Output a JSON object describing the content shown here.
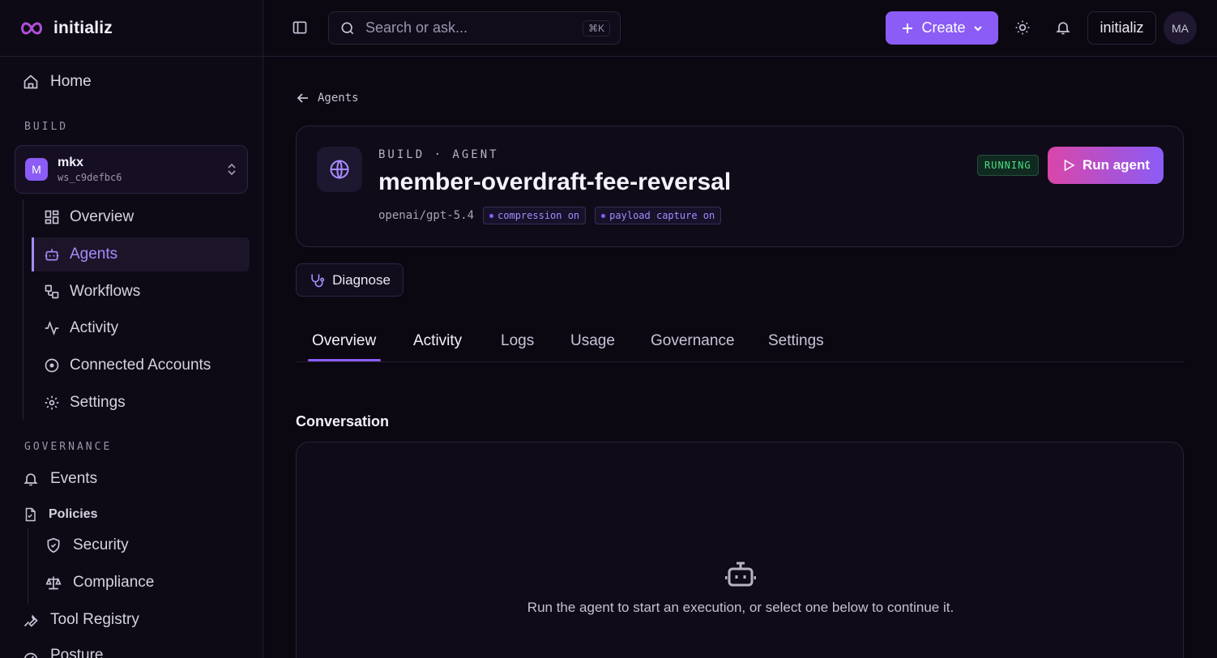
{
  "brand": {
    "name": "initializ"
  },
  "sidebar": {
    "home_label": "Home",
    "build_section_label": "BUILD",
    "workspace": {
      "avatar_letter": "M",
      "name": "mkx",
      "id": "ws_c9defbc6"
    },
    "build_items": [
      {
        "label": "Overview",
        "icon": "grid-icon"
      },
      {
        "label": "Agents",
        "icon": "bot-icon",
        "active": true
      },
      {
        "label": "Workflows",
        "icon": "workflow-icon"
      },
      {
        "label": "Activity",
        "icon": "activity-icon"
      },
      {
        "label": "Connected Accounts",
        "icon": "plug-icon"
      },
      {
        "label": "Settings",
        "icon": "gear-icon"
      }
    ],
    "governance_section_label": "GOVERNANCE",
    "governance_items": {
      "events": "Events",
      "policies": "Policies",
      "security": "Security",
      "compliance": "Compliance",
      "tool_registry": "Tool Registry",
      "posture": "Posture"
    }
  },
  "topbar": {
    "search_placeholder": "Search or ask...",
    "search_shortcut": "⌘K",
    "create_label": "Create",
    "org_label": "initializ",
    "avatar_initials": "MA"
  },
  "breadcrumb": {
    "back_label": "Agents"
  },
  "agent": {
    "eyebrow": "BUILD · AGENT",
    "name": "member-overdraft-fee-reversal",
    "model": "openai/gpt-5.4",
    "pills": [
      "compression on",
      "payload capture on"
    ],
    "status": "RUNNING",
    "run_label": "Run agent"
  },
  "diagnose_label": "Diagnose",
  "tabs": [
    "Overview",
    "Activity",
    "Logs",
    "Usage",
    "Governance",
    "Settings"
  ],
  "conversation": {
    "title": "Conversation",
    "empty_message": "Run the agent to start an execution, or select one below to continue it."
  },
  "colors": {
    "accent": "#8b5cf6",
    "background": "#0b0812",
    "status_running": "#4ade80",
    "run_gradient_start": "#d946a8"
  }
}
